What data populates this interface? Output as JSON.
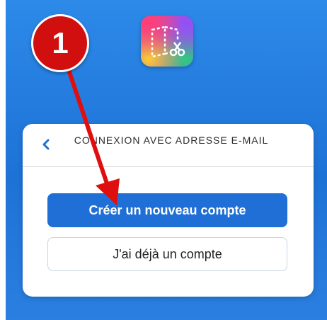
{
  "annotation": {
    "step_number": "1",
    "color": "#d10f0f"
  },
  "app_icon": {
    "name": "book-creator-logo"
  },
  "card": {
    "back_icon": "chevron-left-icon",
    "title": "CONNEXION AVEC ADRESSE E-MAIL",
    "primary_button_label": "Créer un nouveau compte",
    "secondary_button_label": "J'ai déjà un compte"
  },
  "colors": {
    "background": "#1d72d6",
    "primary_button": "#1f6fd6",
    "back_icon": "#1f6fd6"
  }
}
